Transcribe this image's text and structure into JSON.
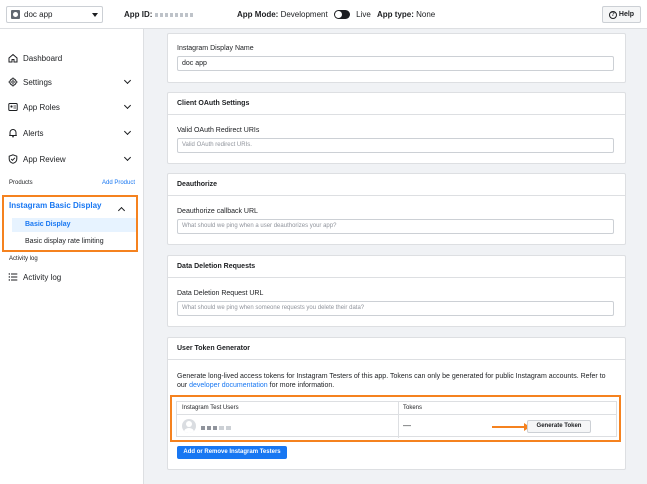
{
  "topbar": {
    "app_name": "doc app",
    "app_id_label": "App ID:",
    "app_mode_label": "App Mode:",
    "app_mode_value": "Development",
    "live_label": "Live",
    "app_type_label": "App type:",
    "app_type_value": "None",
    "help_label": "Help"
  },
  "sidebar": {
    "dashboard": "Dashboard",
    "settings": "Settings",
    "app_roles": "App Roles",
    "alerts": "Alerts",
    "app_review": "App Review",
    "products_label": "Products",
    "add_product": "Add Product",
    "instagram": "Instagram Basic Display",
    "basic_display": "Basic Display",
    "rate_limiting": "Basic display rate limiting",
    "activity_section": "Activity log",
    "activity_log": "Activity log"
  },
  "main": {
    "display_name_label": "Instagram Display Name",
    "display_name_value": "doc app",
    "oauth_title": "Client OAuth Settings",
    "oauth_label": "Valid OAuth Redirect URIs",
    "oauth_placeholder": "Valid OAuth redirect URIs.",
    "deauth_title": "Deauthorize",
    "deauth_label": "Deauthorize callback URL",
    "deauth_placeholder": "What should we ping when a user deauthorizes your app?",
    "deletion_title": "Data Deletion Requests",
    "deletion_label": "Data Deletion Request URL",
    "deletion_placeholder": "What should we ping when someone requests you delete their data?",
    "token_title": "User Token Generator",
    "token_desc_1": "Generate long-lived access tokens for Instagram Testers of this app. Tokens can only be generated for public Instagram accounts. Refer to our ",
    "token_desc_link": "developer documentation",
    "token_desc_2": " for more information.",
    "col_users": "Instagram Test Users",
    "col_tokens": "Tokens",
    "token_value": "—",
    "generate_button": "Generate Token",
    "add_testers_button": "Add or Remove Instagram Testers"
  }
}
